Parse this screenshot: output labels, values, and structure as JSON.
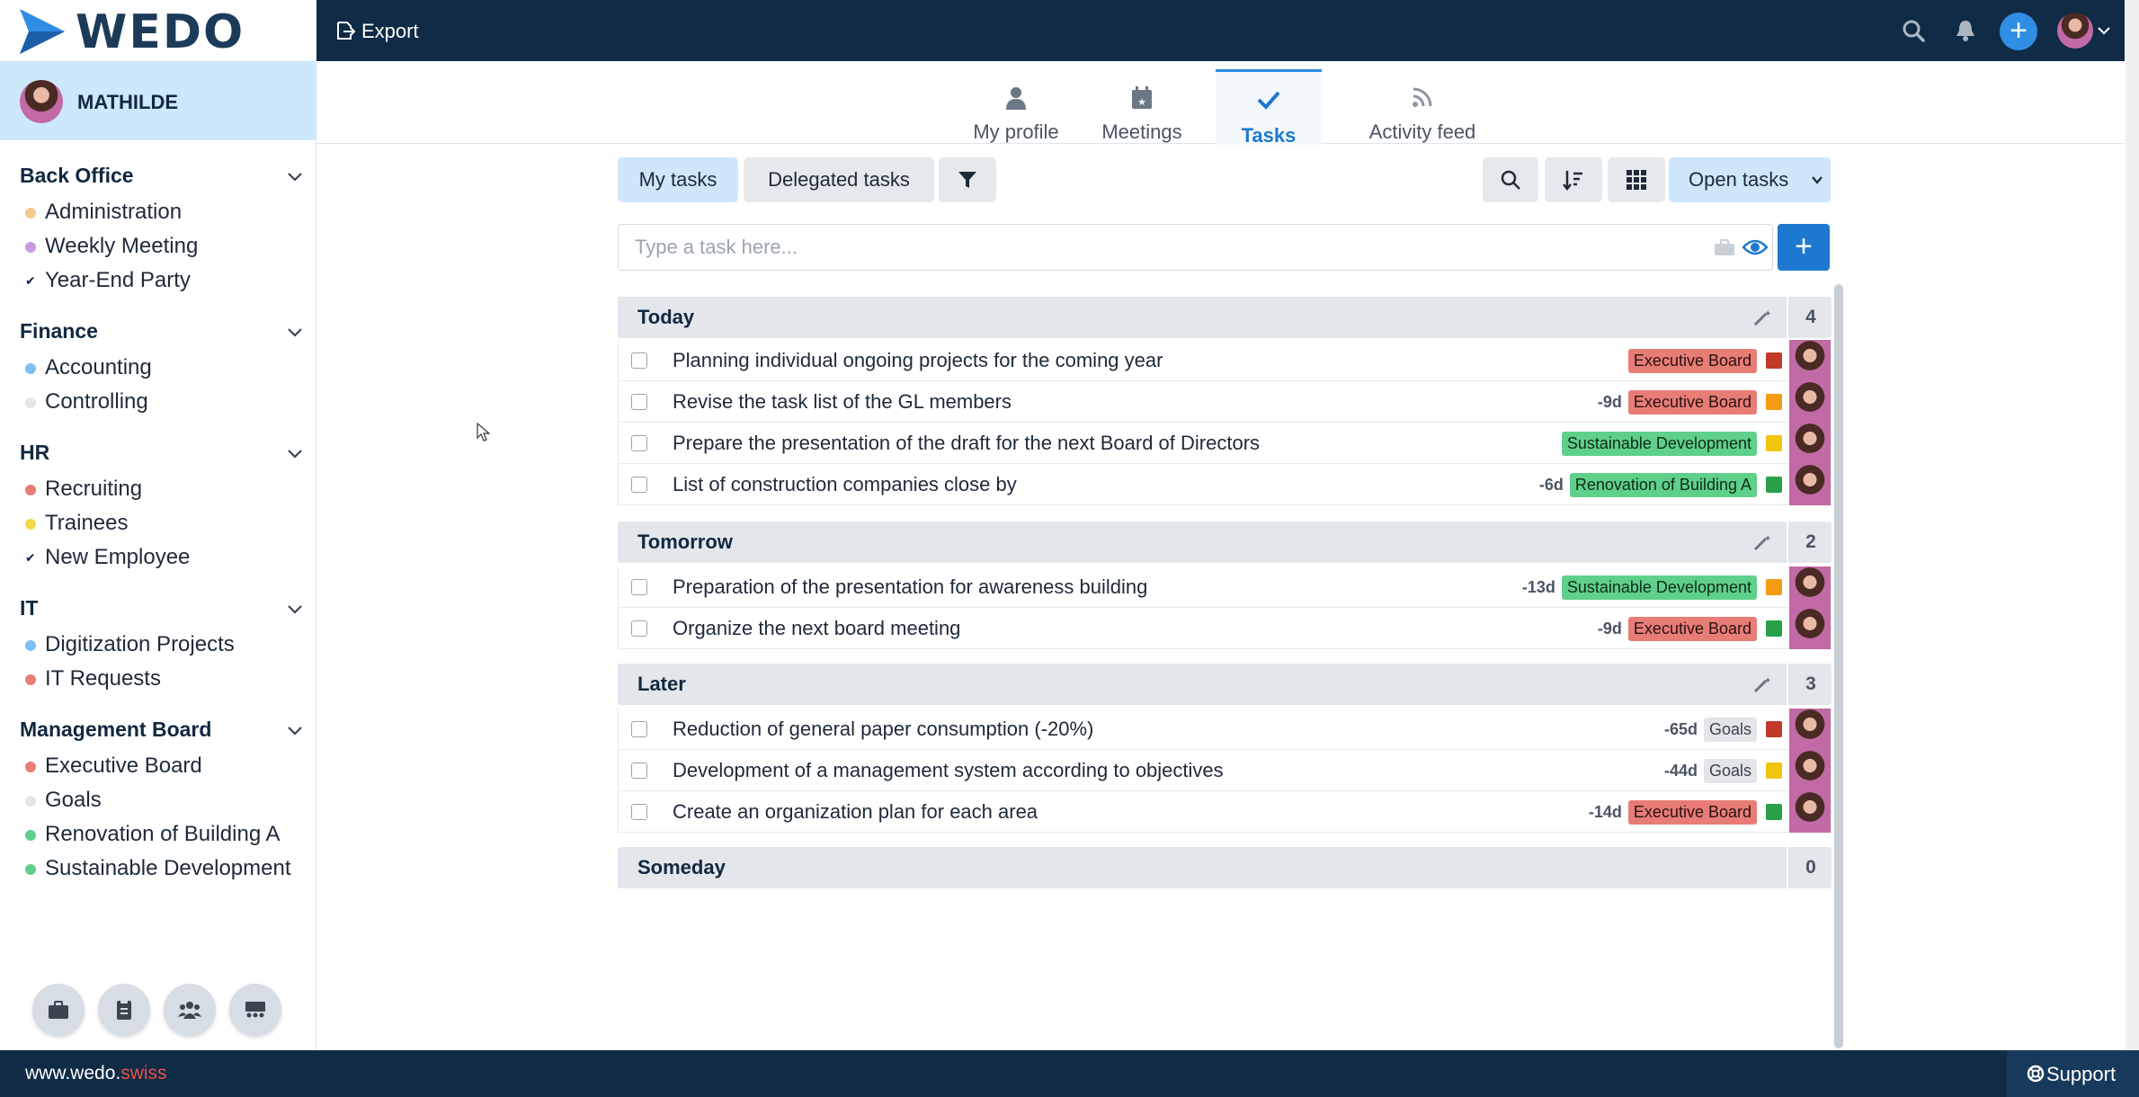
{
  "brand": {
    "logo_text": "WEDO",
    "accent_color": "#2f8de4",
    "navy": "#0f2b45"
  },
  "user": {
    "name": "MATHILDE"
  },
  "sidebar": {
    "groups": [
      {
        "title": "Back Office",
        "items": [
          {
            "label": "Administration",
            "color": "#f6c98d"
          },
          {
            "label": "Weekly Meeting",
            "color": "#c79ce0"
          },
          {
            "label": "Year-End Party",
            "icon": "check-circle-icon"
          }
        ]
      },
      {
        "title": "Finance",
        "items": [
          {
            "label": "Accounting",
            "color": "#7fbff0"
          },
          {
            "label": "Controlling",
            "color": "#e3e5e8"
          }
        ]
      },
      {
        "title": "HR",
        "items": [
          {
            "label": "Recruiting",
            "color": "#e87d76"
          },
          {
            "label": "Trainees",
            "color": "#f5d94a"
          },
          {
            "label": "New Employee",
            "icon": "check-circle-icon"
          }
        ]
      },
      {
        "title": "IT",
        "items": [
          {
            "label": "Digitization Projects",
            "color": "#7fbff0"
          },
          {
            "label": "IT Requests",
            "color": "#e87d76"
          }
        ]
      },
      {
        "title": "Management Board",
        "items": [
          {
            "label": "Executive Board",
            "color": "#e87d76"
          },
          {
            "label": "Goals",
            "color": "#e3e5e8"
          },
          {
            "label": "Renovation of Building A",
            "color": "#5fd08a"
          },
          {
            "label": "Sustainable Development",
            "color": "#5fd08a"
          }
        ]
      }
    ],
    "tools": [
      "briefcase-icon",
      "clipboard-icon",
      "team-icon",
      "meeting-icon"
    ]
  },
  "topbar": {
    "export_label": "Export"
  },
  "tabs": [
    {
      "label": "My profile",
      "icon": "person-icon"
    },
    {
      "label": "Meetings",
      "icon": "calendar-icon"
    },
    {
      "label": "Tasks",
      "icon": "check-icon",
      "active": true
    },
    {
      "label": "Activity feed",
      "icon": "rss-icon"
    }
  ],
  "toolbar": {
    "my_tasks": "My tasks",
    "delegated_tasks": "Delegated tasks",
    "open_tasks": "Open tasks"
  },
  "task_input": {
    "placeholder": "Type a task here...",
    "value": ""
  },
  "sections": [
    {
      "title": "Today",
      "count": "4",
      "tasks": [
        {
          "title": "Planning individual ongoing projects for the coming year",
          "due": "",
          "tag": "Executive Board",
          "tag_color": "red",
          "priority": "#c0392b"
        },
        {
          "title": "Revise the task list of the GL members",
          "due": "-9d",
          "tag": "Executive Board",
          "tag_color": "red",
          "priority": "#f39c12"
        },
        {
          "title": "Prepare the presentation of the draft for the next Board of Directors",
          "due": "",
          "tag": "Sustainable Development",
          "tag_color": "green",
          "priority": "#f1c40f"
        },
        {
          "title": "List of construction companies close by",
          "due": "-6d",
          "tag": "Renovation of Building A",
          "tag_color": "green",
          "priority": "#27a048"
        }
      ]
    },
    {
      "title": "Tomorrow",
      "count": "2",
      "tasks": [
        {
          "title": "Preparation of the presentation for awareness building",
          "due": "-13d",
          "tag": "Sustainable Development",
          "tag_color": "green",
          "priority": "#f39c12"
        },
        {
          "title": "Organize the next board meeting",
          "due": "-9d",
          "tag": "Executive Board",
          "tag_color": "red",
          "priority": "#27a048"
        }
      ]
    },
    {
      "title": "Later",
      "count": "3",
      "tasks": [
        {
          "title": "Reduction of general paper consumption (-20%)",
          "due": "-65d",
          "tag": "Goals",
          "tag_color": "grey",
          "priority": "#c0392b"
        },
        {
          "title": "Development of a management system according to objectives",
          "due": "-44d",
          "tag": "Goals",
          "tag_color": "grey",
          "priority": "#f1c40f"
        },
        {
          "title": "Create an organization plan for each area",
          "due": "-14d",
          "tag": "Executive Board",
          "tag_color": "red",
          "priority": "#27a048"
        }
      ]
    },
    {
      "title": "Someday",
      "count": "0",
      "tasks": []
    }
  ],
  "footer": {
    "site_prefix": "www.wedo.",
    "site_suffix": "swiss",
    "support_label": "Support"
  }
}
